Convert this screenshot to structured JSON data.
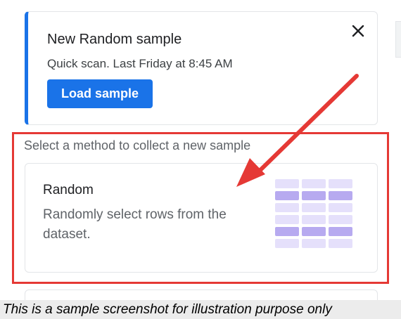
{
  "recent_sample": {
    "title": "New Random sample",
    "subtitle": "Quick scan. Last Friday at 8:45 AM",
    "load_button": "Load sample",
    "close_icon": "close-icon"
  },
  "method_section": {
    "prompt": "Select a method to collect a new sample",
    "methods": [
      {
        "title": "Random",
        "description": "Randomly select rows from the dataset.",
        "icon": "table-rows-illustration"
      }
    ]
  },
  "annotation": {
    "caption": "This is a sample screenshot for illustration purpose only",
    "highlight_color": "#e53935",
    "arrow_color": "#e53935"
  },
  "colors": {
    "accent": "#1a73e8",
    "illustration_light": "#e5e0fb",
    "illustration_dark": "#b7aaf0"
  }
}
